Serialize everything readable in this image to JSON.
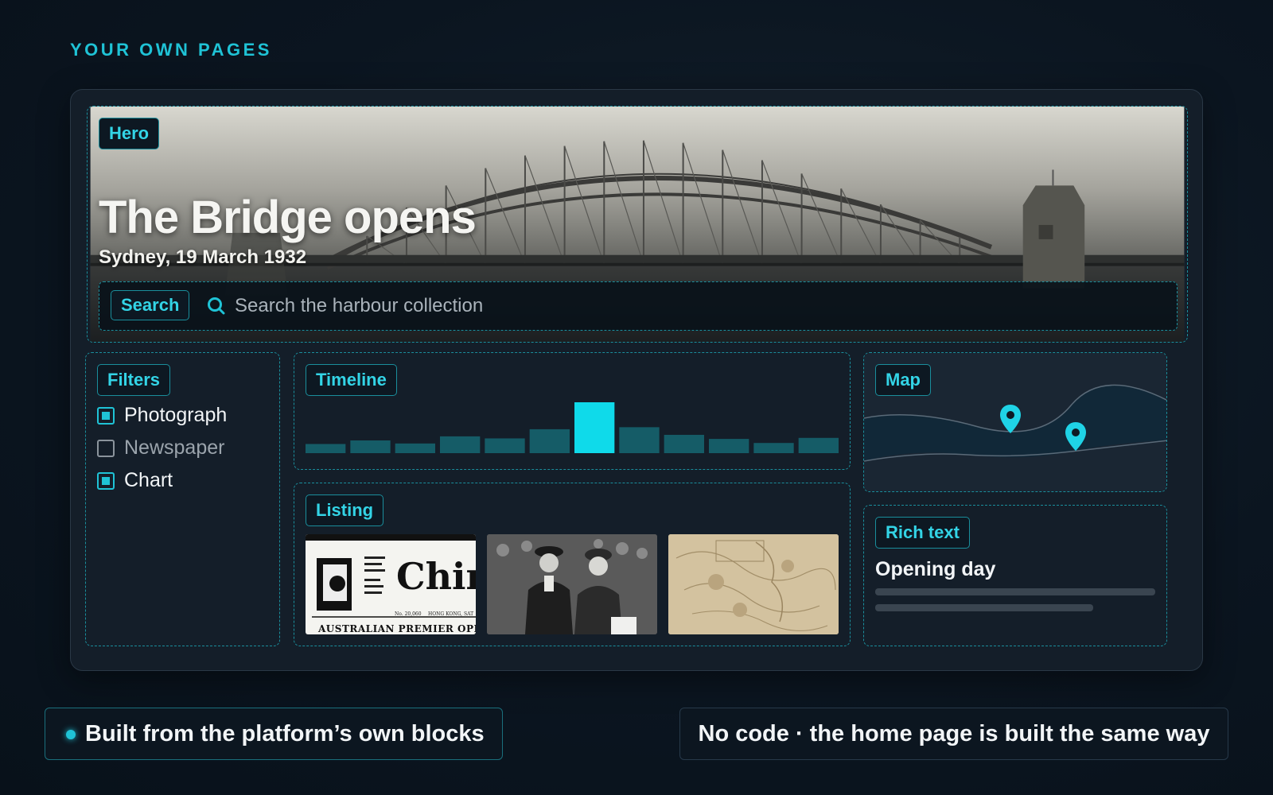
{
  "section_title": "YOUR OWN PAGES",
  "hero": {
    "tag": "Hero",
    "title": "The Bridge opens",
    "subtitle": "Sydney, 19 March 1932"
  },
  "search": {
    "tag": "Search",
    "icon": "search-icon",
    "placeholder": "Search the harbour collection"
  },
  "filters": {
    "tag": "Filters",
    "items": [
      {
        "label": "Photograph",
        "checked": true
      },
      {
        "label": "Newspaper",
        "checked": false
      },
      {
        "label": "Chart",
        "checked": true
      }
    ]
  },
  "timeline": {
    "tag": "Timeline",
    "levels": [
      0.18,
      0.25,
      0.19,
      0.33,
      0.29,
      0.47,
      1.0,
      0.51,
      0.36,
      0.28,
      0.2,
      0.3
    ],
    "highlight_index": 6
  },
  "listing": {
    "tag": "Listing",
    "thumbnail_texts": {
      "masthead": "Chin",
      "issue": "No. 20,060",
      "place": "HONG KONG, SAT",
      "headline": "AUSTRALIAN PREMIER OPEN"
    },
    "thumbnails": [
      "newspaper-thumbnail",
      "photograph-thumbnail",
      "chart-thumbnail"
    ]
  },
  "map": {
    "tag": "Map",
    "pins": [
      "map-pin-icon",
      "map-pin-icon"
    ]
  },
  "richtext": {
    "tag": "Rich text",
    "heading": "Opening day"
  },
  "footer": {
    "left": "Built from the platform’s own blocks",
    "right": "No code · the home page is built the same way"
  },
  "colors": {
    "accent": "#1fc3d6",
    "background": "#0b1520",
    "panel": "#141e29"
  }
}
